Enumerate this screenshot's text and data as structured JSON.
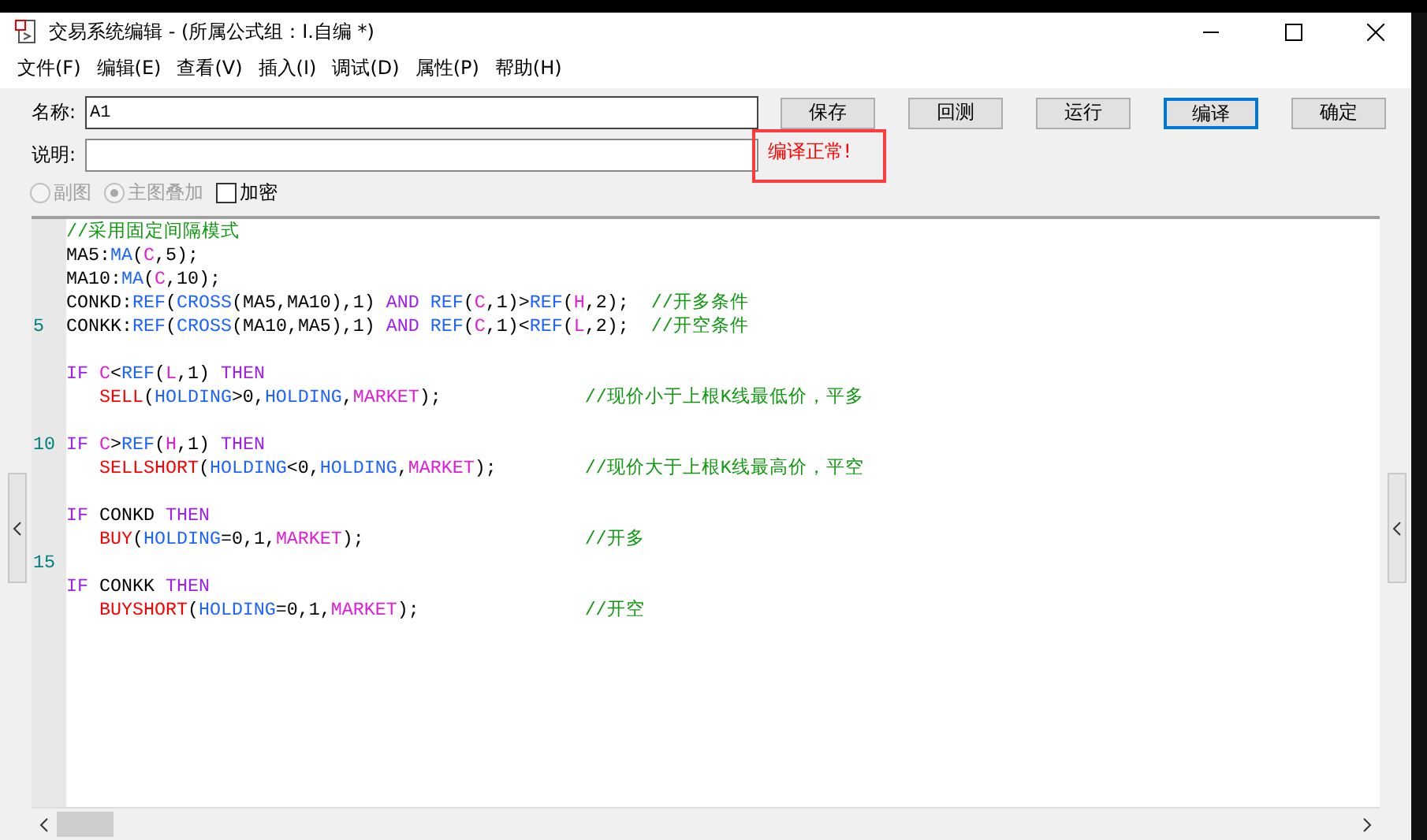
{
  "window": {
    "title": "交易系统编辑 - (所属公式组：I.自编 *)"
  },
  "menu": [
    "文件(F)",
    "编辑(E)",
    "查看(V)",
    "插入(I)",
    "调试(D)",
    "属性(P)",
    "帮助(H)"
  ],
  "form": {
    "name_label": "名称:",
    "name_value": "A1",
    "desc_label": "说明:",
    "buttons": [
      {
        "label": "保存",
        "focused": false
      },
      {
        "label": "回测",
        "focused": false
      },
      {
        "label": "运行",
        "focused": false
      },
      {
        "label": "编译",
        "focused": true
      },
      {
        "label": "确定",
        "focused": false
      }
    ],
    "status_message": "编译正常!",
    "options": [
      {
        "kind": "radio",
        "label": "副图",
        "selected": false,
        "disabled": true
      },
      {
        "kind": "radio",
        "label": "主图叠加",
        "selected": true,
        "disabled": true
      },
      {
        "kind": "checkbox",
        "label": "加密",
        "checked": false,
        "disabled": false
      }
    ]
  },
  "editor": {
    "lines": [
      {
        "kind": "code",
        "tokens": [
          {
            "kind": "comment",
            "text": "//采用固定间隔模式"
          }
        ]
      },
      {
        "kind": "code",
        "tokens": [
          {
            "kind": "plain",
            "text": "MA5:"
          },
          {
            "kind": "func",
            "text": "MA"
          },
          {
            "kind": "plain",
            "text": "("
          },
          {
            "kind": "var",
            "text": "C"
          },
          {
            "kind": "plain",
            "text": ",5);"
          }
        ]
      },
      {
        "kind": "code",
        "tokens": [
          {
            "kind": "plain",
            "text": "MA10:"
          },
          {
            "kind": "func",
            "text": "MA"
          },
          {
            "kind": "plain",
            "text": "("
          },
          {
            "kind": "var",
            "text": "C"
          },
          {
            "kind": "plain",
            "text": ",10);"
          }
        ]
      },
      {
        "kind": "code",
        "tokens": [
          {
            "kind": "plain",
            "text": "CONKD:"
          },
          {
            "kind": "func",
            "text": "REF"
          },
          {
            "kind": "plain",
            "text": "("
          },
          {
            "kind": "func",
            "text": "CROSS"
          },
          {
            "kind": "plain",
            "text": "(MA5,MA10),1) "
          },
          {
            "kind": "keyword",
            "text": "AND"
          },
          {
            "kind": "func",
            "text": "REF"
          },
          {
            "kind": "plain",
            "text": "("
          },
          {
            "kind": "var",
            "text": "C"
          },
          {
            "kind": "plain",
            "text": ",1)>"
          },
          {
            "kind": "func",
            "text": "REF"
          },
          {
            "kind": "plain",
            "text": "("
          },
          {
            "kind": "var",
            "text": "H"
          },
          {
            "kind": "plain",
            "text": ",2);  "
          },
          {
            "kind": "comment",
            "text": "//开多条件"
          }
        ]
      },
      {
        "kind": "code",
        "number": "5",
        "tokens": [
          {
            "kind": "plain",
            "text": "CONKK:"
          },
          {
            "kind": "func",
            "text": "REF"
          },
          {
            "kind": "plain",
            "text": "("
          },
          {
            "kind": "func",
            "text": "CROSS"
          },
          {
            "kind": "plain",
            "text": "(MA10,MA5),1) "
          },
          {
            "kind": "keyword",
            "text": "AND"
          },
          {
            "kind": "func",
            "text": "REF"
          },
          {
            "kind": "plain",
            "text": "("
          },
          {
            "kind": "var",
            "text": "C"
          },
          {
            "kind": "plain",
            "text": ",1)<"
          },
          {
            "kind": "func",
            "text": "REF"
          },
          {
            "kind": "plain",
            "text": "("
          },
          {
            "kind": "var",
            "text": "L"
          },
          {
            "kind": "plain",
            "text": ",2);  "
          },
          {
            "kind": "comment",
            "text": "//开空条件"
          }
        ]
      },
      {
        "kind": "blank"
      },
      {
        "kind": "code",
        "tokens": [
          {
            "kind": "keyword",
            "text": "IF"
          },
          {
            "kind": "var",
            "text": "C"
          },
          {
            "kind": "plain",
            "text": "<"
          },
          {
            "kind": "func",
            "text": "REF"
          },
          {
            "kind": "plain",
            "text": "("
          },
          {
            "kind": "var",
            "text": "L"
          },
          {
            "kind": "plain",
            "text": ",1) "
          },
          {
            "kind": "keyword",
            "text": "THEN"
          }
        ]
      },
      {
        "kind": "code",
        "indented": true,
        "tokens": [
          {
            "kind": "action",
            "text": "SELL"
          },
          {
            "kind": "plain",
            "text": "("
          },
          {
            "kind": "func",
            "text": "HOLDING"
          },
          {
            "kind": "plain",
            "text": ">0,"
          },
          {
            "kind": "func",
            "text": "HOLDING"
          },
          {
            "kind": "plain",
            "text": ","
          },
          {
            "kind": "var",
            "text": "MARKET"
          },
          {
            "kind": "plain",
            "text": ");             "
          },
          {
            "kind": "comment",
            "text": "//现价小于上根K线最低价，平多"
          }
        ]
      },
      {
        "kind": "blank"
      },
      {
        "kind": "code",
        "number": "10",
        "tokens": [
          {
            "kind": "keyword",
            "text": "IF"
          },
          {
            "kind": "var",
            "text": "C"
          },
          {
            "kind": "plain",
            "text": ">"
          },
          {
            "kind": "func",
            "text": "REF"
          },
          {
            "kind": "plain",
            "text": "("
          },
          {
            "kind": "var",
            "text": "H"
          },
          {
            "kind": "plain",
            "text": ",1) "
          },
          {
            "kind": "keyword",
            "text": "THEN"
          }
        ]
      },
      {
        "kind": "code",
        "indented": true,
        "tokens": [
          {
            "kind": "action",
            "text": "SELLSHORT"
          },
          {
            "kind": "plain",
            "text": "("
          },
          {
            "kind": "func",
            "text": "HOLDING"
          },
          {
            "kind": "plain",
            "text": "<0,"
          },
          {
            "kind": "func",
            "text": "HOLDING"
          },
          {
            "kind": "plain",
            "text": ","
          },
          {
            "kind": "var",
            "text": "MARKET"
          },
          {
            "kind": "plain",
            "text": ");        "
          },
          {
            "kind": "comment",
            "text": "//现价大于上根K线最高价，平空"
          }
        ]
      },
      {
        "kind": "blank"
      },
      {
        "kind": "code",
        "tokens": [
          {
            "kind": "keyword",
            "text": "IF"
          },
          {
            "kind": "plain",
            "text": " CONKD "
          },
          {
            "kind": "keyword",
            "text": "THEN"
          }
        ]
      },
      {
        "kind": "code",
        "indented": true,
        "tokens": [
          {
            "kind": "action",
            "text": "BUY"
          },
          {
            "kind": "plain",
            "text": "("
          },
          {
            "kind": "func",
            "text": "HOLDING"
          },
          {
            "kind": "plain",
            "text": "=0,1,"
          },
          {
            "kind": "var",
            "text": "MARKET"
          },
          {
            "kind": "plain",
            "text": ");                    "
          },
          {
            "kind": "comment",
            "text": "//开多"
          }
        ]
      },
      {
        "kind": "blank",
        "number": "15"
      },
      {
        "kind": "code",
        "tokens": [
          {
            "kind": "keyword",
            "text": "IF"
          },
          {
            "kind": "plain",
            "text": " CONKK "
          },
          {
            "kind": "keyword",
            "text": "THEN"
          }
        ]
      },
      {
        "kind": "code",
        "indented": true,
        "tokens": [
          {
            "kind": "action",
            "text": "BUYSHORT"
          },
          {
            "kind": "plain",
            "text": "("
          },
          {
            "kind": "func",
            "text": "HOLDING"
          },
          {
            "kind": "plain",
            "text": "=0,1,"
          },
          {
            "kind": "var",
            "text": "MARKET"
          },
          {
            "kind": "plain",
            "text": ");               "
          },
          {
            "kind": "comment",
            "text": "//开空"
          }
        ]
      }
    ]
  }
}
